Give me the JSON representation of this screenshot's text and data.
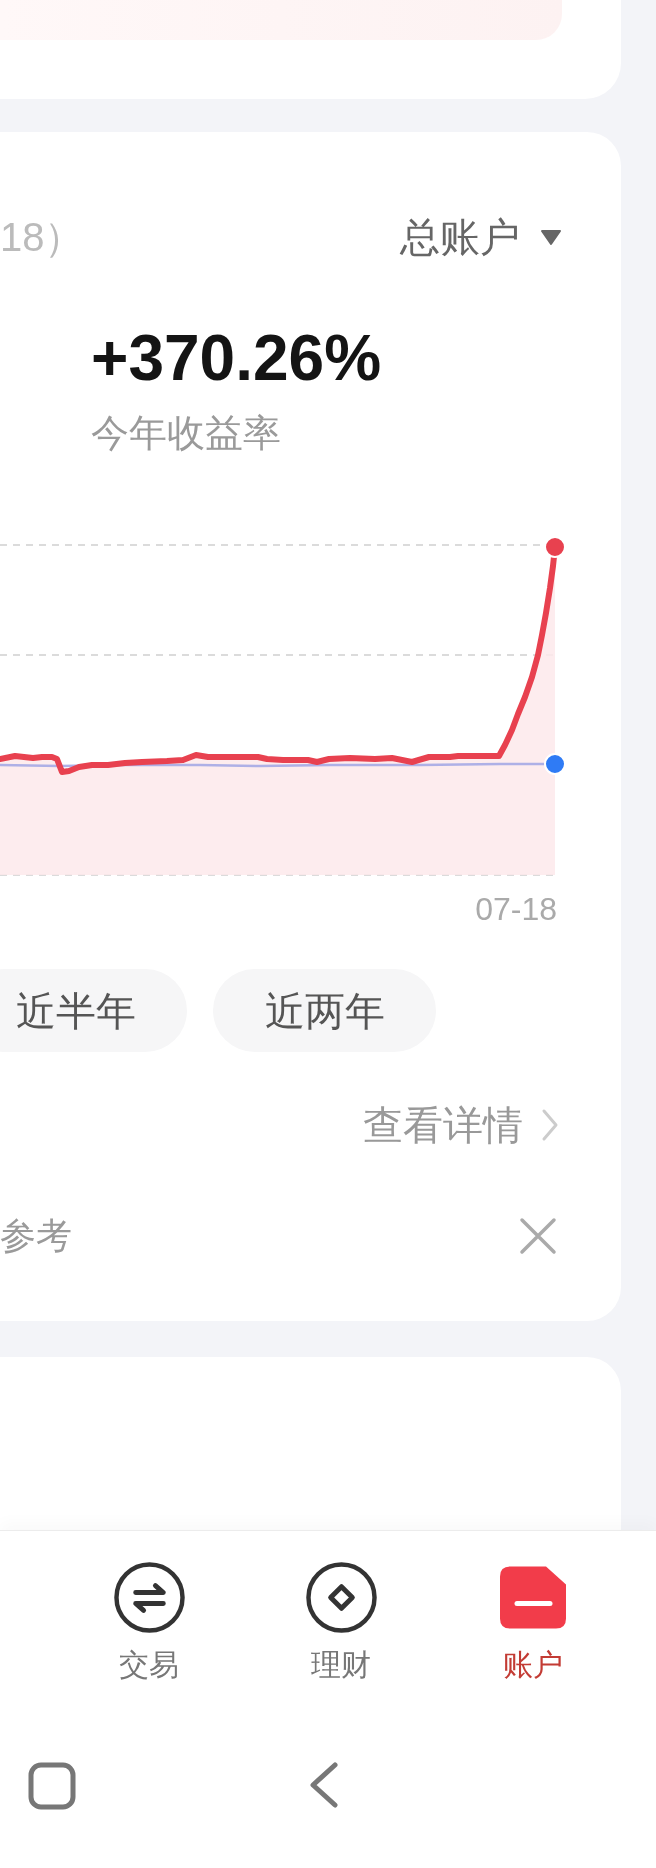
{
  "returns_card": {
    "date_note": "18）",
    "account_selector": {
      "label": "总账户"
    },
    "stat": {
      "value": "+370.26%",
      "label": "今年收益率"
    },
    "chart": {
      "x_label": "07-18"
    },
    "periods": [
      {
        "label": "近半年",
        "selected": false
      },
      {
        "label": "近两年",
        "selected": false
      }
    ],
    "details_link": "查看详情",
    "disclaimer": "参考"
  },
  "tab_bar": [
    {
      "label": "交易",
      "kind": "exchange",
      "selected": false
    },
    {
      "label": "理财",
      "kind": "finance",
      "selected": false
    },
    {
      "label": "账户",
      "kind": "account",
      "selected": true
    }
  ]
}
